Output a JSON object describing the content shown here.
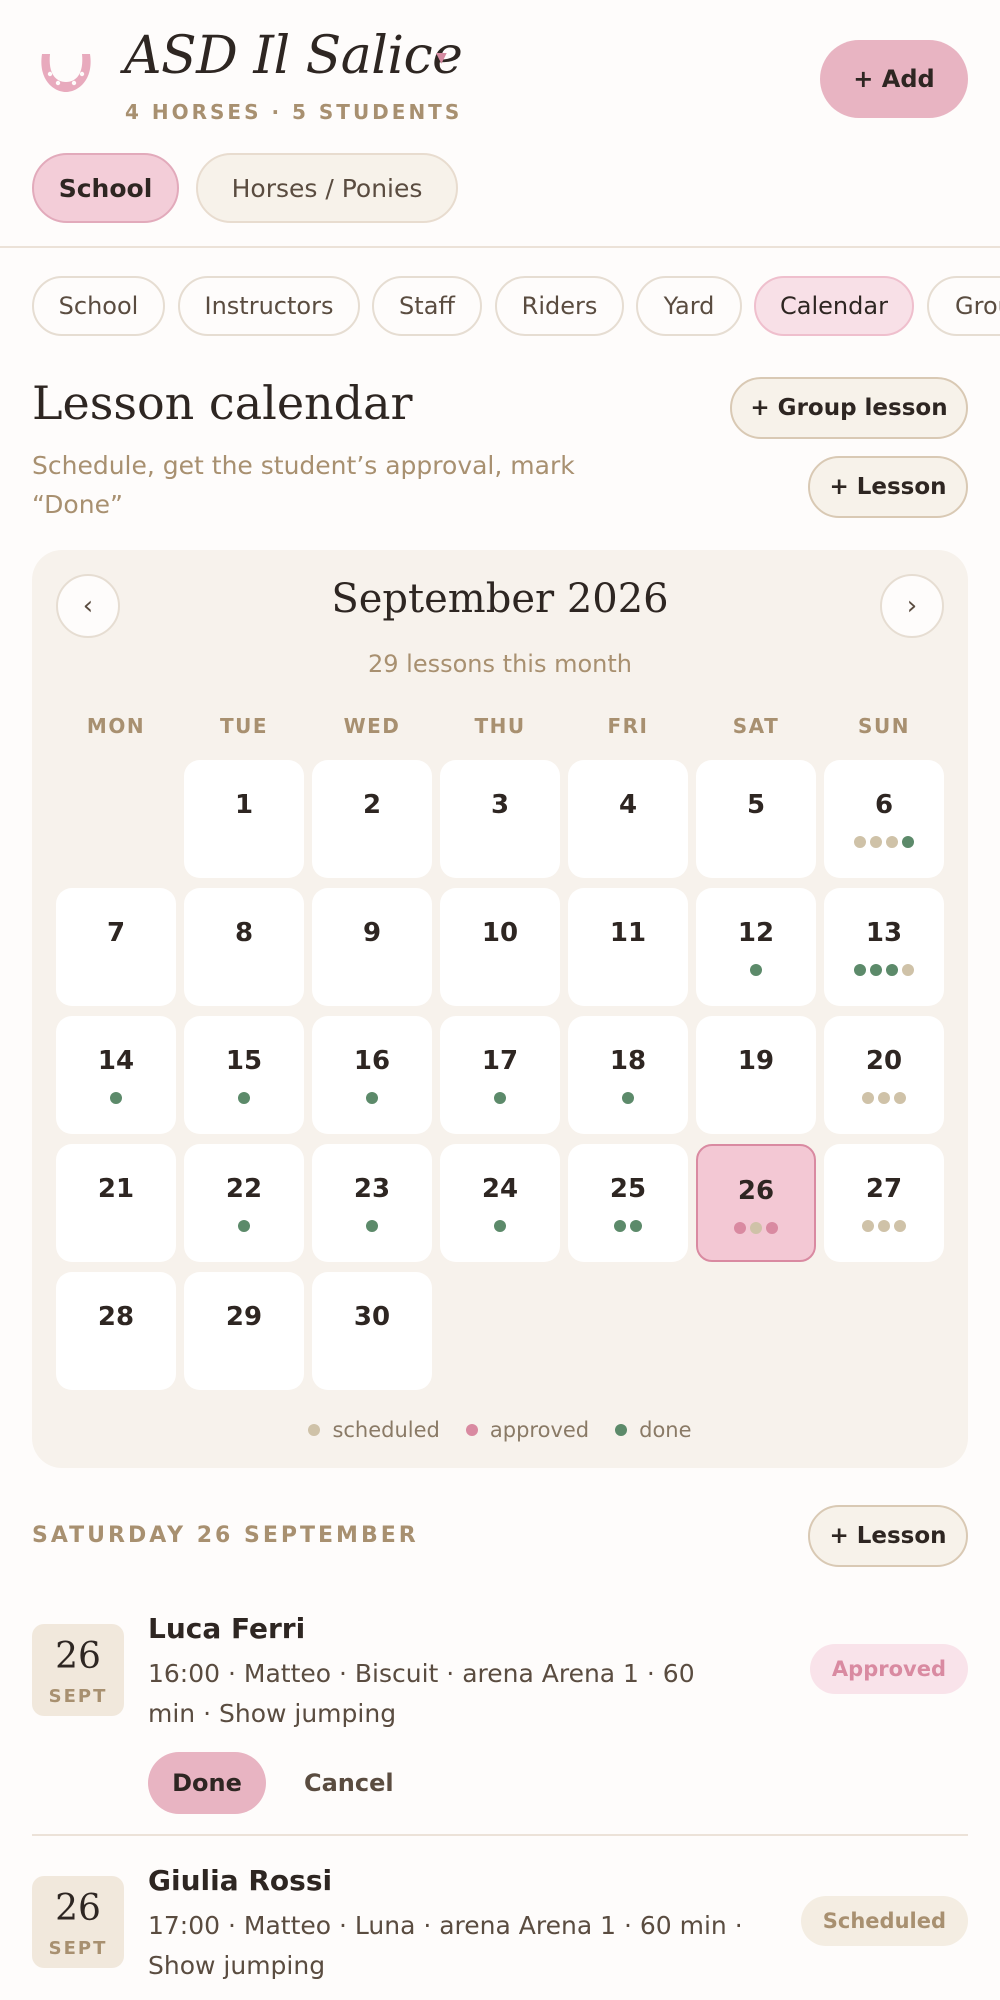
{
  "header": {
    "title": "ASD Il Salice",
    "subtitle": "4 HORSES · 5 STUDENTS",
    "add_label": "+ Add",
    "segments": [
      "School",
      "Horses / Ponies"
    ],
    "active_segment": "School",
    "colors": {
      "accent": "#e8b4c2",
      "muted": "#a89070"
    }
  },
  "tabs": {
    "items": [
      "School",
      "Instructors",
      "Staff",
      "Riders",
      "Yard",
      "Calendar",
      "Grou"
    ],
    "active": "Calendar"
  },
  "section": {
    "title": "Lesson calendar",
    "subtitle": "Schedule, get the student’s approval, mark “Done”",
    "group_lesson_label": "+ Group lesson",
    "lesson_label": "+ Lesson"
  },
  "calendar": {
    "prev_icon": "chevron-left-icon",
    "next_icon": "chevron-right-icon",
    "prev_glyph": "‹",
    "next_glyph": "›",
    "month_title": "September 2026",
    "month_sub": "29 lessons this month",
    "weekdays": [
      "MON",
      "TUE",
      "WED",
      "THU",
      "FRI",
      "SAT",
      "SUN"
    ],
    "first_weekday_index": 1,
    "selected_day": 26,
    "days": [
      {
        "n": "1",
        "dots": []
      },
      {
        "n": "2",
        "dots": []
      },
      {
        "n": "3",
        "dots": []
      },
      {
        "n": "4",
        "dots": []
      },
      {
        "n": "5",
        "dots": []
      },
      {
        "n": "6",
        "dots": [
          "scheduled",
          "scheduled",
          "scheduled",
          "done"
        ]
      },
      {
        "n": "7",
        "dots": []
      },
      {
        "n": "8",
        "dots": []
      },
      {
        "n": "9",
        "dots": []
      },
      {
        "n": "10",
        "dots": []
      },
      {
        "n": "11",
        "dots": []
      },
      {
        "n": "12",
        "dots": [
          "done"
        ]
      },
      {
        "n": "13",
        "dots": [
          "done",
          "done",
          "done",
          "scheduled"
        ]
      },
      {
        "n": "14",
        "dots": [
          "done"
        ]
      },
      {
        "n": "15",
        "dots": [
          "done"
        ]
      },
      {
        "n": "16",
        "dots": [
          "done"
        ]
      },
      {
        "n": "17",
        "dots": [
          "done"
        ]
      },
      {
        "n": "18",
        "dots": [
          "done"
        ]
      },
      {
        "n": "19",
        "dots": []
      },
      {
        "n": "20",
        "dots": [
          "scheduled",
          "scheduled",
          "scheduled"
        ]
      },
      {
        "n": "21",
        "dots": []
      },
      {
        "n": "22",
        "dots": [
          "done"
        ]
      },
      {
        "n": "23",
        "dots": [
          "done"
        ]
      },
      {
        "n": "24",
        "dots": [
          "done"
        ]
      },
      {
        "n": "25",
        "dots": [
          "done",
          "done"
        ]
      },
      {
        "n": "26",
        "dots": [
          "approved",
          "scheduled",
          "approved"
        ]
      },
      {
        "n": "27",
        "dots": [
          "scheduled",
          "scheduled",
          "scheduled"
        ]
      },
      {
        "n": "28",
        "dots": []
      },
      {
        "n": "29",
        "dots": []
      },
      {
        "n": "30",
        "dots": []
      }
    ],
    "legend": [
      {
        "key": "scheduled",
        "label": "scheduled",
        "color": "#cfc2a8"
      },
      {
        "key": "approved",
        "label": "approved",
        "color": "#d98aa1"
      },
      {
        "key": "done",
        "label": "done",
        "color": "#5c8a6a"
      }
    ]
  },
  "day_detail": {
    "heading": "SATURDAY 26 SEPTEMBER",
    "lesson_label": "+ Lesson",
    "lessons": [
      {
        "day": "26",
        "month": "SEPT",
        "student": "Luca Ferri",
        "details": "16:00 · Matteo · Biscuit · arena Arena 1 · 60 min · Show jumping",
        "status": "Approved",
        "done_label": "Done",
        "cancel_label": "Cancel"
      },
      {
        "day": "26",
        "month": "SEPT",
        "student": "Giulia Rossi",
        "details": "17:00 · Matteo · Luna · arena Arena 1 · 60 min · Show jumping",
        "status": "Scheduled"
      }
    ]
  }
}
